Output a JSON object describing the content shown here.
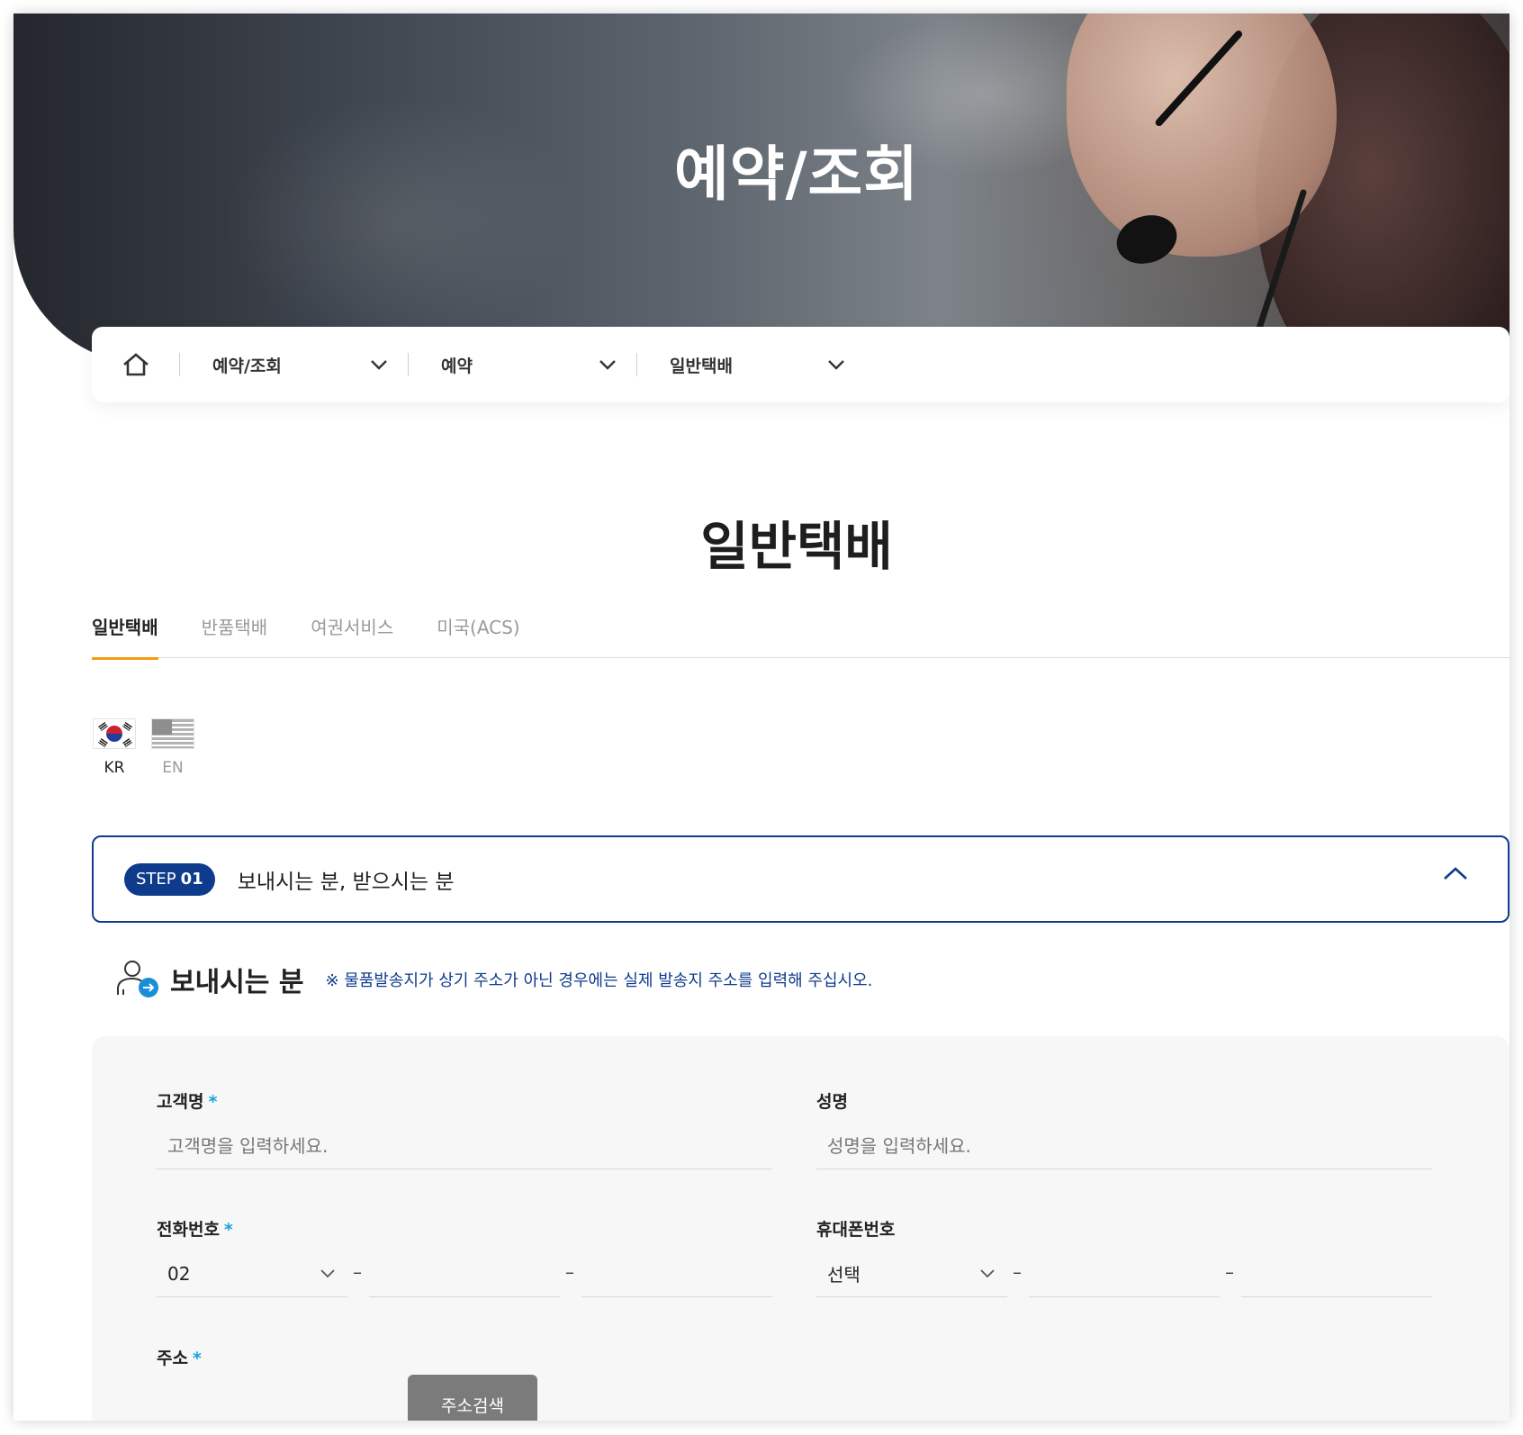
{
  "hero": {
    "title": "예약/조회"
  },
  "breadcrumb": {
    "items": [
      {
        "label": "예약/조회"
      },
      {
        "label": "예약"
      },
      {
        "label": "일반택배"
      }
    ]
  },
  "page": {
    "title": "일반택배"
  },
  "tabs": [
    {
      "label": "일반택배",
      "active": true
    },
    {
      "label": "반품택배",
      "active": false
    },
    {
      "label": "여권서비스",
      "active": false
    },
    {
      "label": "미국(ACS)",
      "active": false
    }
  ],
  "languages": [
    {
      "code": "KR",
      "active": true
    },
    {
      "code": "EN",
      "active": false
    }
  ],
  "step": {
    "badge_prefix": "STEP",
    "badge_number": "01",
    "title": "보내시는 분, 받으시는 분"
  },
  "sender": {
    "title": "보내시는 분",
    "note": "※ 물품발송지가 상기 주소가 아닌 경우에는 실제 발송지 주소를 입력해 주십시오."
  },
  "form": {
    "customer_name": {
      "label": "고객명",
      "required_mark": "*",
      "placeholder": "고객명을 입력하세요.",
      "value": ""
    },
    "name": {
      "label": "성명",
      "placeholder": "성명을 입력하세요.",
      "value": ""
    },
    "phone": {
      "label": "전화번호",
      "required_mark": "*",
      "area_code": "02",
      "separator": "–"
    },
    "mobile": {
      "label": "휴대폰번호",
      "prefix": "선택",
      "separator": "–"
    },
    "address": {
      "label": "주소",
      "required_mark": "*",
      "search_button": "주소검색"
    }
  },
  "colors": {
    "accent_navy": "#0e3b8c",
    "tab_underline": "#f39c12",
    "required": "#1aa3d9",
    "button_gray": "#7b7b7b"
  }
}
